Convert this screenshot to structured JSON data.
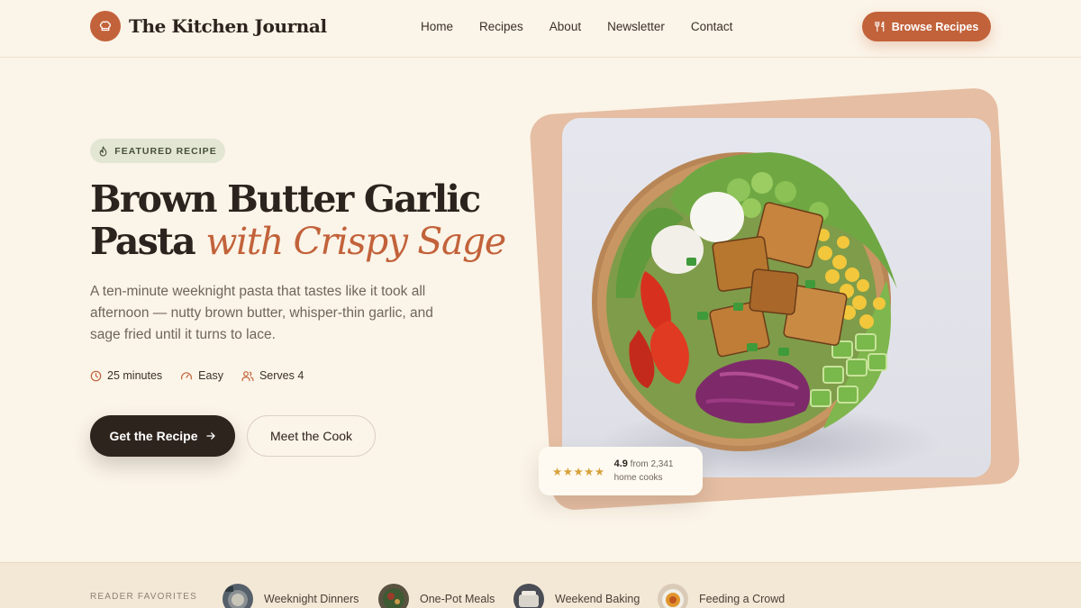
{
  "header": {
    "brand": "The Kitchen Journal",
    "nav": [
      "Home",
      "Recipes",
      "About",
      "Newsletter",
      "Contact"
    ],
    "cta_label": "Browse Recipes"
  },
  "hero": {
    "badge": "FEATURED RECIPE",
    "title_line1": "Brown Butter Garlic",
    "title_line2_plain": "Pasta",
    "title_line2_accent": "with Crispy Sage",
    "subtitle": "A ten-minute weeknight pasta that tastes like it took all afternoon — nutty brown butter, whisper-thin garlic, and sage fried until it turns to lace.",
    "meta": {
      "time": "25 minutes",
      "difficulty": "Easy",
      "serves": "Serves 4"
    },
    "primary_cta": "Get the Recipe",
    "secondary_cta": "Meet the Cook"
  },
  "rating": {
    "stars": 5,
    "score": "4.9",
    "from_text": "from 2,341",
    "label": "home cooks"
  },
  "favorites": {
    "label": "READER FAVORITES",
    "items": [
      "Weeknight Dinners",
      "One-Pot Meals",
      "Weekend Baking",
      "Feeding a Crowd"
    ]
  },
  "colors": {
    "background": "#fbf4e8",
    "accent": "#c2623a",
    "dark": "#2e241e",
    "badge_bg": "#e3e6d3",
    "visual_frame": "#e5bea3",
    "star": "#d7a13a"
  },
  "icons": {
    "brand": "chef-hat-icon",
    "browse": "utensils-icon",
    "badge": "flame-icon",
    "time": "clock-icon",
    "difficulty": "gauge-icon",
    "serves": "users-icon",
    "cta_arrow": "arrow-right-icon",
    "rating": "star-icon"
  }
}
